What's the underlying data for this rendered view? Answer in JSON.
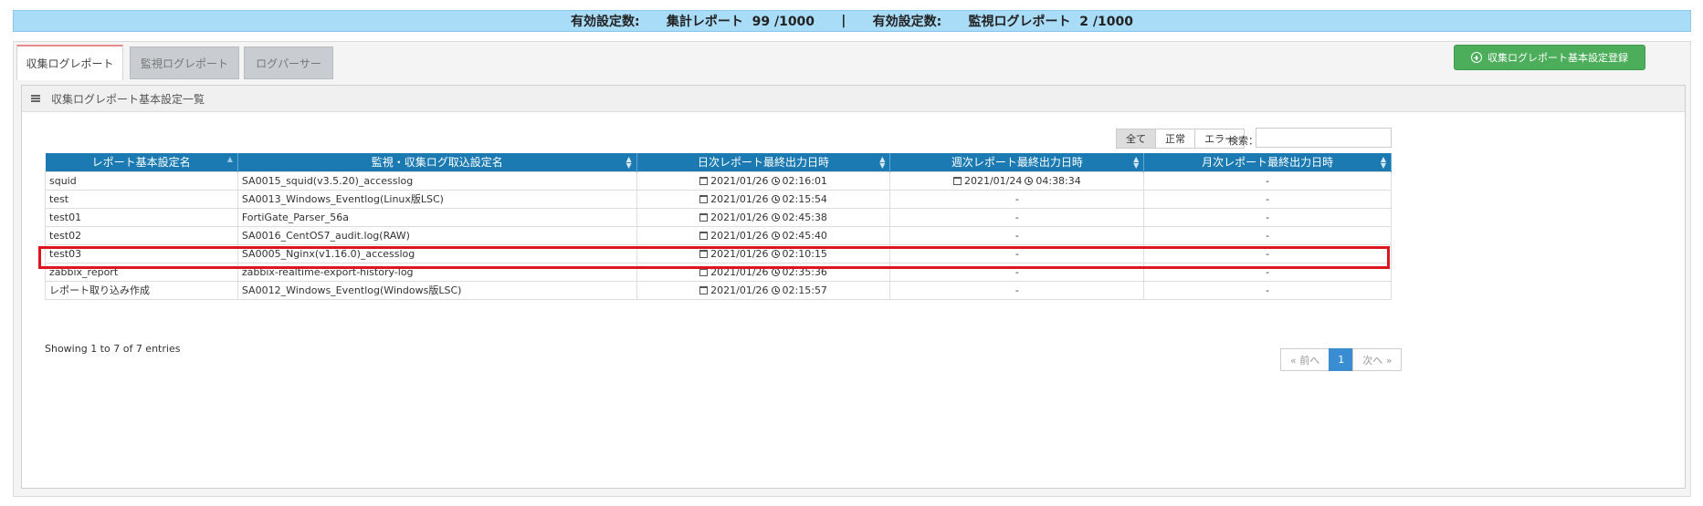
{
  "banner": {
    "label1": "有効設定数:",
    "value1": "集計レポート  99 /1000",
    "separator": "|",
    "label2": "有効設定数:",
    "value2": "監視ログレポート  2 /1000"
  },
  "tabs": [
    "収集ログレポート",
    "監視ログレポート",
    "ログパーサー"
  ],
  "register_button": "収集ログレポート基本設定登録",
  "panel_title": "収集ログレポート基本設定一覧",
  "filters": [
    "全て",
    "正常",
    "エラー"
  ],
  "search": {
    "label": "検索：",
    "value": ""
  },
  "table": {
    "headers": [
      "レポート基本設定名",
      "監視・収集ログ取込設定名",
      "日次レポート最終出力日時",
      "週次レポート最終出力日時",
      "月次レポート最終出力日時"
    ],
    "rows": [
      {
        "name": "squid",
        "setting": "SA0015_squid(v3.5.20)_accesslog",
        "daily_date": "2021/01/26",
        "daily_time": "02:16:01",
        "weekly_date": "2021/01/24",
        "weekly_time": "04:38:34",
        "weekly": "",
        "monthly": "-"
      },
      {
        "name": "test",
        "setting": "SA0013_Windows_Eventlog(Linux版LSC)",
        "daily_date": "2021/01/26",
        "daily_time": "02:15:54",
        "weekly": "-",
        "monthly": "-"
      },
      {
        "name": "test01",
        "setting": "FortiGate_Parser_56a",
        "daily_date": "2021/01/26",
        "daily_time": "02:45:38",
        "weekly": "-",
        "monthly": "-"
      },
      {
        "name": "test02",
        "setting": "SA0016_CentOS7_audit.log(RAW)",
        "daily_date": "2021/01/26",
        "daily_time": "02:45:40",
        "weekly": "-",
        "monthly": "-"
      },
      {
        "name": "test03",
        "setting": "SA0005_Nginx(v1.16.0)_accesslog",
        "daily_date": "2021/01/26",
        "daily_time": "02:10:15",
        "weekly": "-",
        "monthly": "-"
      },
      {
        "name": "zabbix_report",
        "setting": "zabbix-realtime-export-history-log",
        "daily_date": "2021/01/26",
        "daily_time": "02:35:36",
        "weekly": "-",
        "monthly": "-"
      },
      {
        "name": "レポート取り込み作成",
        "setting": "SA0012_Windows_Eventlog(Windows版LSC)",
        "daily_date": "2021/01/26",
        "daily_time": "02:15:57",
        "weekly": "-",
        "monthly": "-"
      }
    ]
  },
  "info": "Showing 1 to 7 of 7 entries",
  "pager": {
    "prev": "« 前へ",
    "current": "1",
    "next": "次へ »"
  },
  "colors": {
    "header_bg": "#1a7ab1",
    "highlight": "#e0141e",
    "register_btn": "#4cad5a",
    "banner_bg": "#a9dcf7"
  }
}
